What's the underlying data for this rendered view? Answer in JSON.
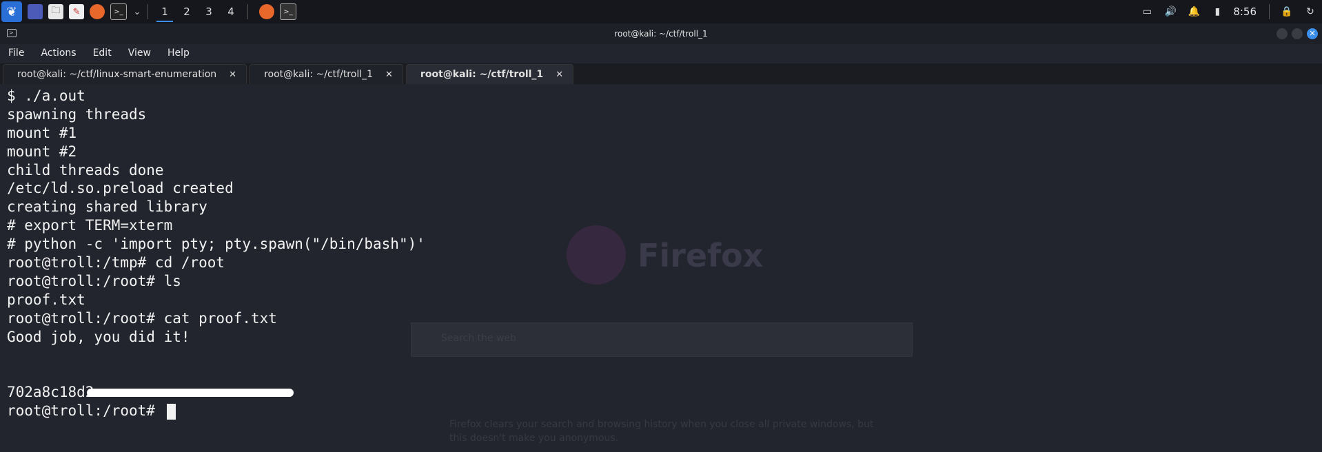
{
  "panel": {
    "workspaces": [
      "1",
      "2",
      "3",
      "4"
    ],
    "active_workspace": "1",
    "clock": "8:56"
  },
  "window": {
    "title": "root@kali: ~/ctf/troll_1",
    "menu": [
      "File",
      "Actions",
      "Edit",
      "View",
      "Help"
    ],
    "tabs": [
      {
        "label": "root@kali: ~/ctf/linux-smart-enumeration",
        "active": false
      },
      {
        "label": "root@kali: ~/ctf/troll_1",
        "active": false
      },
      {
        "label": "root@kali: ~/ctf/troll_1",
        "active": true
      }
    ]
  },
  "background": {
    "firefox_word": "Firefox",
    "search_placeholder": "Search the web",
    "private_note": "Firefox clears your search and browsing history when you close all private windows, but this doesn't make you anonymous."
  },
  "terminal": {
    "lines": [
      "$ ./a.out",
      "spawning threads",
      "mount #1",
      "mount #2",
      "child threads done",
      "/etc/ld.so.preload created",
      "creating shared library",
      "# export TERM=xterm",
      "# python -c 'import pty; pty.spawn(\"/bin/bash\")'",
      "root@troll:/tmp# cd /root",
      "root@troll:/root# ls",
      "proof.txt",
      "root@troll:/root# cat proof.txt",
      "Good job, you did it!",
      "",
      ""
    ],
    "hash_visible": "702a8c18d2",
    "prompt": "root@troll:/root# "
  },
  "colors": {
    "terminal_bg": "#23252e",
    "accent": "#3b8eea",
    "text": "#f2f2f2"
  }
}
